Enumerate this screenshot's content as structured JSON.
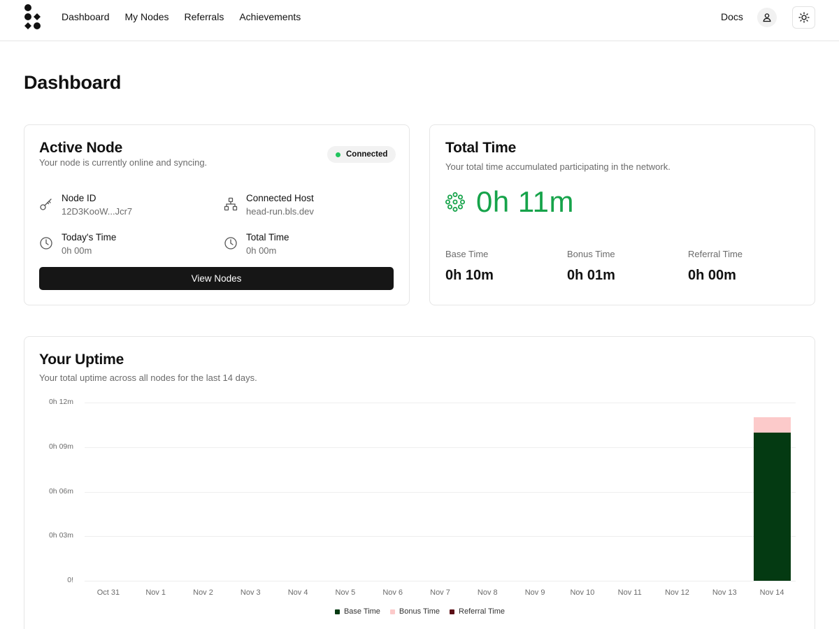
{
  "nav": {
    "items": [
      "Dashboard",
      "My Nodes",
      "Referrals",
      "Achievements"
    ],
    "docs": "Docs"
  },
  "page_title": "Dashboard",
  "active_node": {
    "title": "Active Node",
    "subtitle": "Your node is currently online and syncing.",
    "status": "Connected",
    "status_color": "#22c55e",
    "node_id_label": "Node ID",
    "node_id": "12D3KooW...Jcr7",
    "host_label": "Connected Host",
    "host": "head-run.bls.dev",
    "today_label": "Today's Time",
    "today": "0h 00m",
    "total_label": "Total Time",
    "total": "0h 00m",
    "button": "View Nodes"
  },
  "total_time": {
    "title": "Total Time",
    "subtitle": "Your total time accumulated participating in the network.",
    "value": "0h 11m",
    "accent": "#16a34a",
    "base_label": "Base Time",
    "base": "0h 10m",
    "bonus_label": "Bonus Time",
    "bonus": "0h 01m",
    "referral_label": "Referral Time",
    "referral": "0h 00m"
  },
  "uptime": {
    "title": "Your Uptime",
    "subtitle": "Your total uptime across all nodes for the last 14 days."
  },
  "chart_data": {
    "type": "bar",
    "stacked": true,
    "categories": [
      "Oct 31",
      "Nov 1",
      "Nov 2",
      "Nov 3",
      "Nov 4",
      "Nov 5",
      "Nov 6",
      "Nov 7",
      "Nov 8",
      "Nov 9",
      "Nov 10",
      "Nov 11",
      "Nov 12",
      "Nov 13",
      "Nov 14"
    ],
    "series": [
      {
        "name": "Base Time",
        "color": "#043a12",
        "values": [
          0,
          0,
          0,
          0,
          0,
          0,
          0,
          0,
          0,
          0,
          0,
          0,
          0,
          0,
          10
        ]
      },
      {
        "name": "Bonus Time",
        "color": "#fccaca",
        "values": [
          0,
          0,
          0,
          0,
          0,
          0,
          0,
          0,
          0,
          0,
          0,
          0,
          0,
          0,
          1
        ]
      },
      {
        "name": "Referral Time",
        "color": "#5c0f16",
        "values": [
          0,
          0,
          0,
          0,
          0,
          0,
          0,
          0,
          0,
          0,
          0,
          0,
          0,
          0,
          0
        ]
      }
    ],
    "y_ticks": [
      0,
      3,
      6,
      9,
      12
    ],
    "y_tick_labels": [
      "0h 12m",
      "0h 09m",
      "0h 06m",
      "0h 03m",
      "0!"
    ],
    "ylim": [
      0,
      12
    ],
    "y_unit": "minutes",
    "grid": true,
    "legend": "bottom-center"
  }
}
